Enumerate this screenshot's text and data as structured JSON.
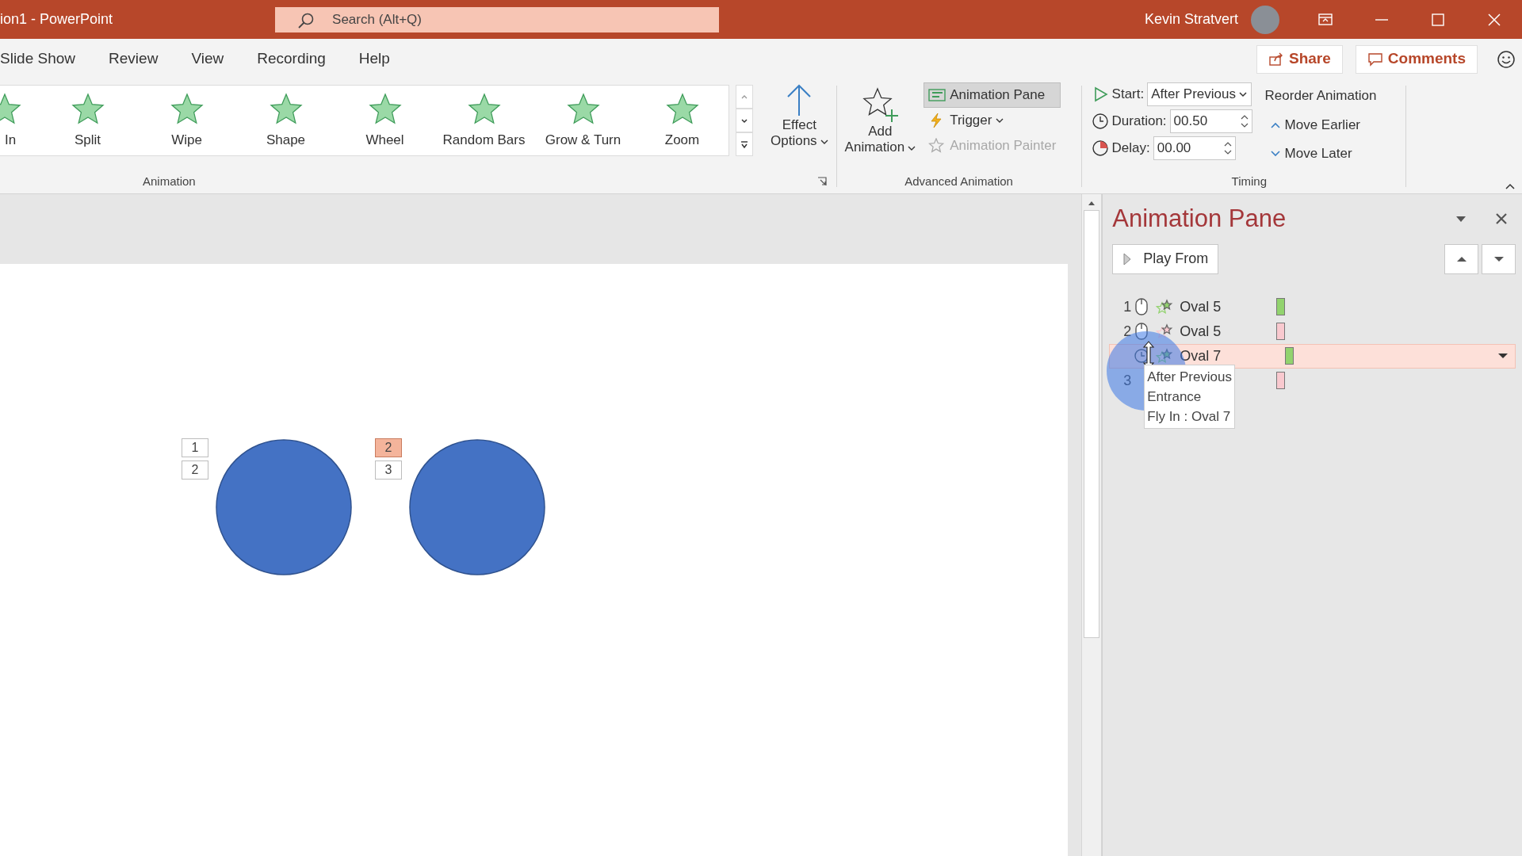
{
  "window": {
    "title": "ion1  -  PowerPoint",
    "search": {
      "placeholder": "Search (Alt+Q)"
    },
    "user": "Kevin Stratvert"
  },
  "ribbon_tabs": [
    {
      "label": "Slide Show"
    },
    {
      "label": "Review"
    },
    {
      "label": "View"
    },
    {
      "label": "Recording"
    },
    {
      "label": "Help"
    }
  ],
  "share": "Share",
  "comments": "Comments",
  "animation_group": {
    "label": "Animation",
    "effects": [
      {
        "label": "In"
      },
      {
        "label": "Split"
      },
      {
        "label": "Wipe"
      },
      {
        "label": "Shape"
      },
      {
        "label": "Wheel"
      },
      {
        "label": "Random Bars"
      },
      {
        "label": "Grow & Turn"
      },
      {
        "label": "Zoom"
      }
    ],
    "effect_options": [
      "Effect",
      "Options"
    ]
  },
  "advanced_group": {
    "label": "Advanced Animation",
    "add_animation": [
      "Add",
      "Animation"
    ],
    "buttons": [
      {
        "kind": "pane",
        "label": "Animation Pane",
        "selected": true,
        "disabled": false
      },
      {
        "kind": "trigger",
        "label": "Trigger",
        "selected": false,
        "disabled": false
      },
      {
        "kind": "painter",
        "label": "Animation Painter",
        "selected": false,
        "disabled": true
      }
    ]
  },
  "timing_group": {
    "label": "Timing",
    "start_label": "Start:",
    "start_value": "After Previous",
    "duration_label": "Duration:",
    "duration_value": "00.50",
    "delay_label": "Delay:",
    "delay_value": "00.00",
    "reorder_label": "Reorder Animation",
    "move_earlier": "Move Earlier",
    "move_later": "Move Later"
  },
  "slide": {
    "shapes": [
      {
        "tags": [
          {
            "label": "1",
            "selected": false
          },
          {
            "label": "2",
            "selected": false
          }
        ]
      },
      {
        "tags": [
          {
            "label": "2",
            "selected": true
          },
          {
            "label": "3",
            "selected": false
          }
        ]
      }
    ]
  },
  "animation_pane": {
    "title": "Animation Pane",
    "play_from": "Play From",
    "items": [
      {
        "number": "1",
        "kind": "click",
        "color": "#92d36e",
        "label": "Oval 5",
        "selected": false
      },
      {
        "number": "2",
        "kind": "click",
        "color": "#f9c9cf",
        "label": "Oval 5",
        "selected": false
      },
      {
        "kind": "after",
        "color": "#92d36e",
        "label": "Oval 7",
        "selected": true
      },
      {
        "number": "3",
        "color": "#f9c9cf",
        "selected": false
      }
    ],
    "tooltip": [
      "After Previous",
      "Entrance",
      "Fly In : Oval 7"
    ]
  }
}
